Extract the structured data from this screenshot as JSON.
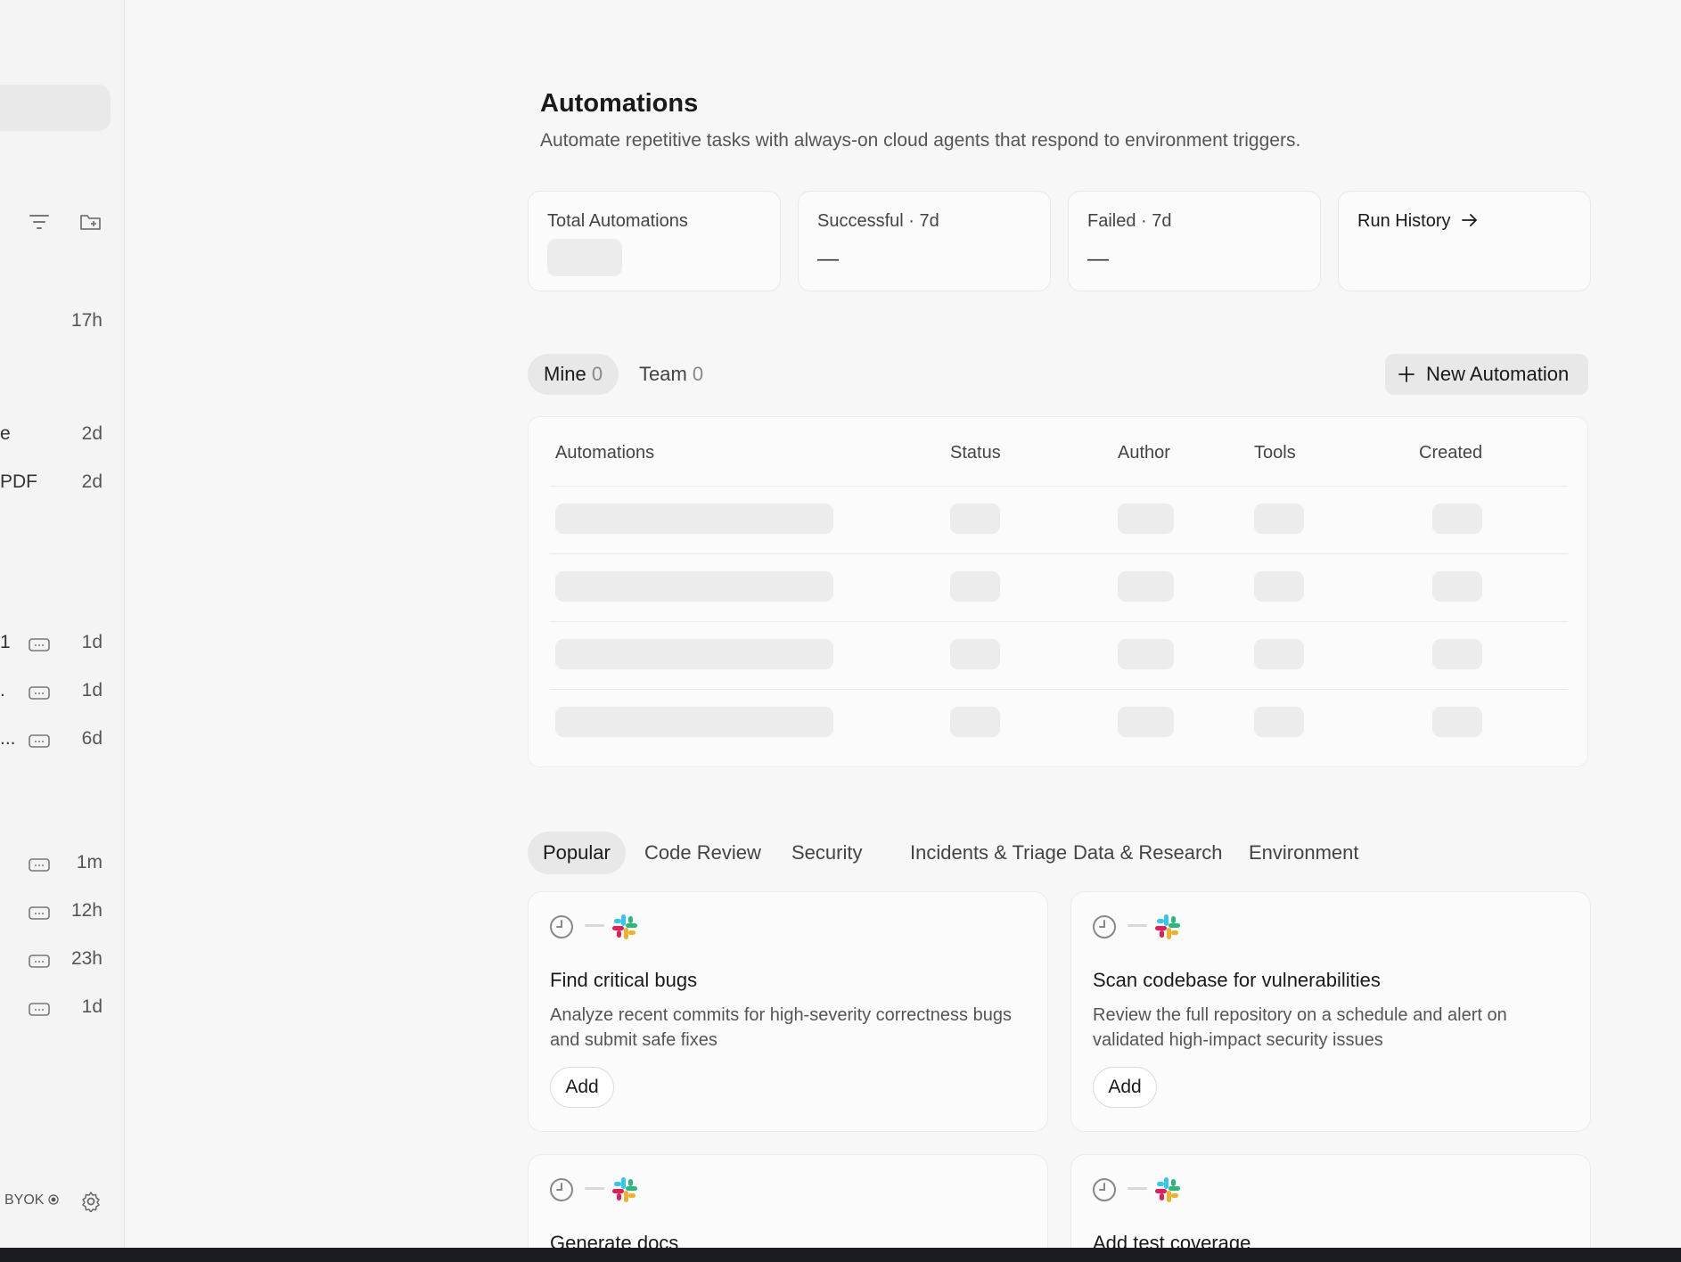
{
  "sidebar": {
    "rows": [
      {
        "frag": "",
        "time": "17h",
        "box": false
      },
      {
        "frag": "e",
        "time": "2d",
        "box": false
      },
      {
        "frag": "PDF",
        "time": "2d",
        "box": false
      },
      {
        "frag": "1",
        "time": "1d",
        "box": true
      },
      {
        "frag": ".",
        "time": "1d",
        "box": true
      },
      {
        "frag": "...",
        "time": "6d",
        "box": true
      },
      {
        "frag": "",
        "time": "1m",
        "box": true
      },
      {
        "frag": "",
        "time": "12h",
        "box": true
      },
      {
        "frag": "",
        "time": "23h",
        "box": true
      },
      {
        "frag": "",
        "time": "1d",
        "box": true
      }
    ],
    "footer_label": "BYOK"
  },
  "header": {
    "title": "Automations",
    "subtitle": "Automate repetitive tasks with always-on cloud agents that respond to environment triggers."
  },
  "stats": {
    "total_label": "Total Automations",
    "successful_label": "Successful · 7d",
    "successful_value": "—",
    "failed_label": "Failed · 7d",
    "failed_value": "—",
    "run_history_label": "Run History"
  },
  "segments": {
    "mine_label": "Mine",
    "mine_count": "0",
    "team_label": "Team",
    "team_count": "0"
  },
  "new_automation_label": "New Automation",
  "table": {
    "columns": [
      "Automations",
      "Status",
      "Author",
      "Tools",
      "Created"
    ]
  },
  "categories": [
    "Popular",
    "Code Review",
    "Security",
    "Incidents & Triage",
    "Data & Research",
    "Environment"
  ],
  "templates": [
    {
      "title": "Find critical bugs",
      "desc": "Analyze recent commits for high-severity correctness bugs and submit safe fixes",
      "add": "Add"
    },
    {
      "title": "Scan codebase for vulnerabilities",
      "desc": "Review the full repository on a schedule and alert on validated high-impact security issues",
      "add": "Add"
    },
    {
      "title": "Generate docs"
    },
    {
      "title": "Add test coverage"
    }
  ],
  "colors": {
    "background": "#f7f7f7",
    "sidebar": "#f4f4f4",
    "skeleton": "#ececec",
    "active_pill": "#e8e8e8",
    "slack_blue": "#36C5F0",
    "slack_green": "#2EB67D",
    "slack_yellow": "#ECB22E",
    "slack_red": "#E01E5A"
  },
  "icons": {
    "filter": "filter-icon",
    "new_folder": "new-folder-icon",
    "settings": "gear-icon",
    "arrow": "arrow-right-icon",
    "plus": "plus-icon",
    "trigger": "clock-icon",
    "integration": "slack-icon"
  }
}
